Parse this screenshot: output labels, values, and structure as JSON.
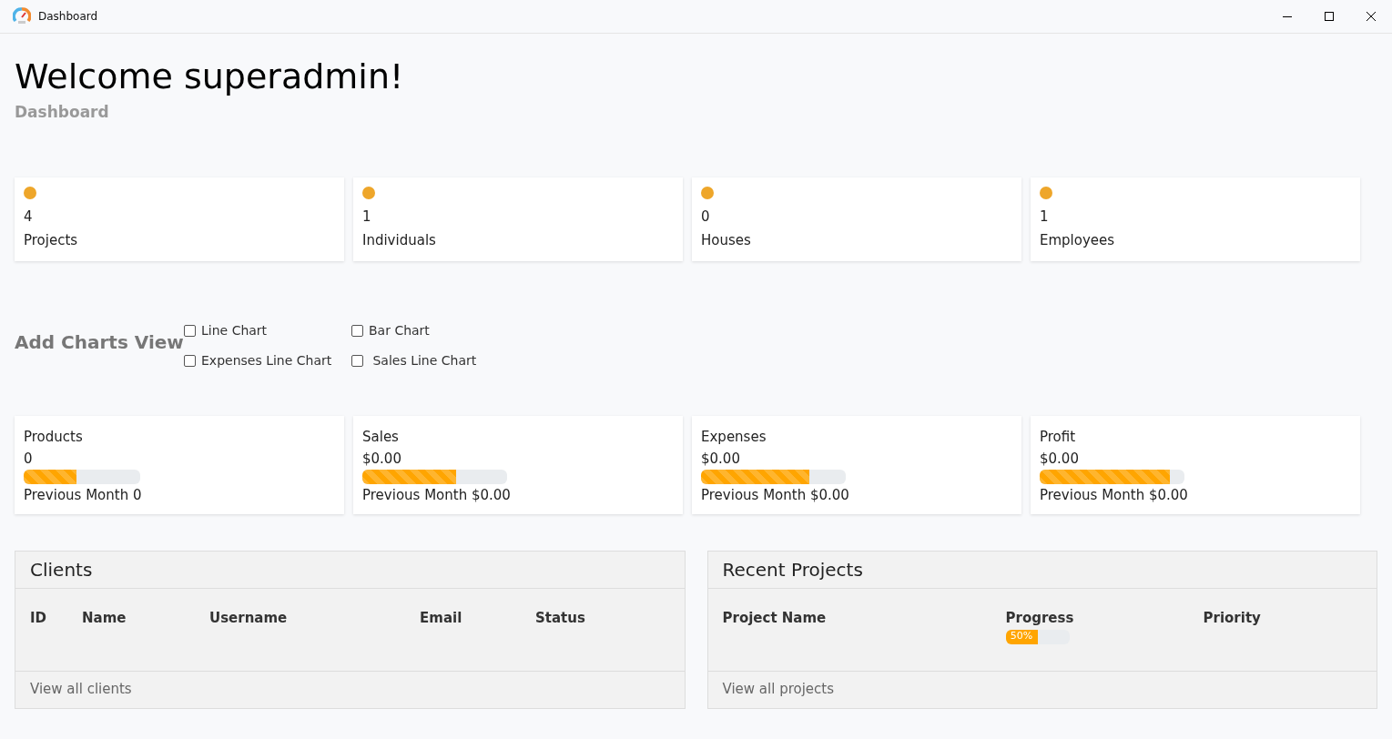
{
  "window": {
    "title": "Dashboard"
  },
  "heading": "Welcome superadmin!",
  "subheading": "Dashboard",
  "stats": [
    {
      "value": "4",
      "label": "Projects"
    },
    {
      "value": "1",
      "label": "Individuals"
    },
    {
      "value": "0",
      "label": "Houses"
    },
    {
      "value": "1",
      "label": "Employees"
    }
  ],
  "charts_view": {
    "title": "Add Charts View",
    "options": [
      {
        "label": "Line Chart",
        "checked": false
      },
      {
        "label": "Bar Chart",
        "checked": false
      },
      {
        "label": "Expenses Line Chart",
        "checked": false
      },
      {
        "label": " Sales Line Chart",
        "checked": false
      }
    ]
  },
  "metrics": [
    {
      "label": "Products",
      "value": "0",
      "level": 0.45,
      "previous": "Previous Month 0"
    },
    {
      "label": "Sales",
      "value": "$0.00",
      "level": 0.65,
      "previous": "Previous Month $0.00"
    },
    {
      "label": "Expenses",
      "value": "$0.00",
      "level": 0.75,
      "previous": "Previous Month $0.00"
    },
    {
      "label": "Profit",
      "value": "$0.00",
      "level": 0.9,
      "previous": "Previous Month $0.00"
    }
  ],
  "clients": {
    "title": "Clients",
    "columns": [
      "ID",
      "Name",
      "Username",
      "Email",
      "Status"
    ],
    "footer_link": "View all clients"
  },
  "recent_projects": {
    "title": "Recent Projects",
    "columns": [
      "Project Name",
      "Progress",
      "Priority"
    ],
    "progress": {
      "label": "50%",
      "level": 0.5
    },
    "footer_link": "View all projects"
  }
}
